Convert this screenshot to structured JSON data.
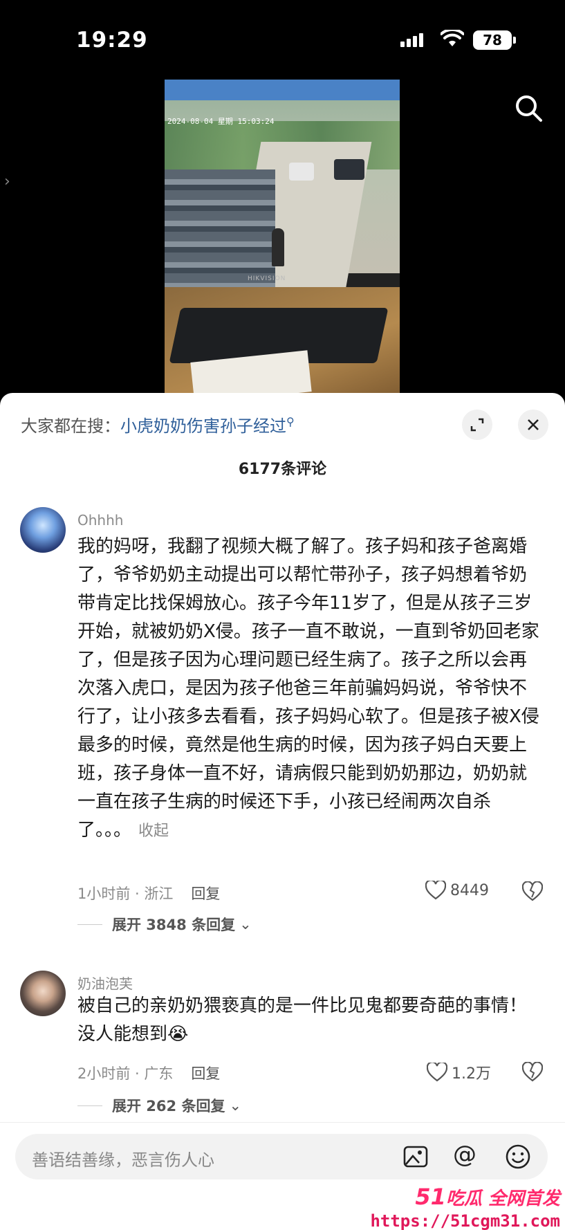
{
  "status_bar": {
    "time": "19:29",
    "battery": "78",
    "icons": [
      "signal-icon",
      "wifi-icon",
      "battery-icon"
    ]
  },
  "video": {
    "overlay_icons": [
      "search-icon",
      "chevron-right-icon"
    ],
    "cctv_timestamp": "2024-08-04 星期 15:03:24",
    "monitor_brand": "HIKVISION"
  },
  "panel": {
    "trending_prefix": "大家都在搜：",
    "trending_link": "小虎奶奶伤害孙子经过",
    "comment_count": "6177条评论"
  },
  "comments": [
    {
      "user": "Ohhhh",
      "text": "我的妈呀，我翻了视频大概了解了。孩子妈和孩子爸离婚了，爷爷奶奶主动提出可以帮忙带孙子，孩子妈想着爷奶带肯定比找保姆放心。孩子今年11岁了，但是从孩子三岁开始，就被奶奶X侵。孩子一直不敢说，一直到爷奶回老家了，但是孩子因为心理问题已经生病了。孩子之所以会再次落入虎口，是因为孩子他爸三年前骗妈妈说，爷爷快不行了，让小孩多去看看，孩子妈妈心软了。但是孩子被X侵最多的时候，竟然是他生病的时候，因为孩子妈白天要上班，孩子身体一直不好，请病假只能到奶奶那边，奶奶就一直在孩子生病的时候还下手，小孩已经闹两次自杀了。。。",
      "fold": "收起",
      "meta": "1小时前 · 浙江",
      "reply": "回复",
      "likes": "8449",
      "expand": "展开 3848 条回复"
    },
    {
      "user": "奶油泡芙",
      "text": "被自己的亲奶奶猥亵真的是一件比见鬼都要奇葩的事情！没人能想到😭",
      "meta": "2小时前 · 广东",
      "reply": "回复",
      "likes": "1.2万",
      "expand": "展开 262 条回复"
    }
  ],
  "input": {
    "placeholder": "善语结善缘，恶言伤人心",
    "icons": [
      "image-icon",
      "at-icon",
      "emoji-icon"
    ],
    "at_symbol": "@"
  },
  "watermark": {
    "brand_num": "51",
    "brand_text": "吃瓜 全网首发",
    "url": "https://51cgm31.com"
  },
  "colors": {
    "link": "#2f5f9a",
    "watermark": "#ff2a6d",
    "muted": "#8a8a8a"
  }
}
